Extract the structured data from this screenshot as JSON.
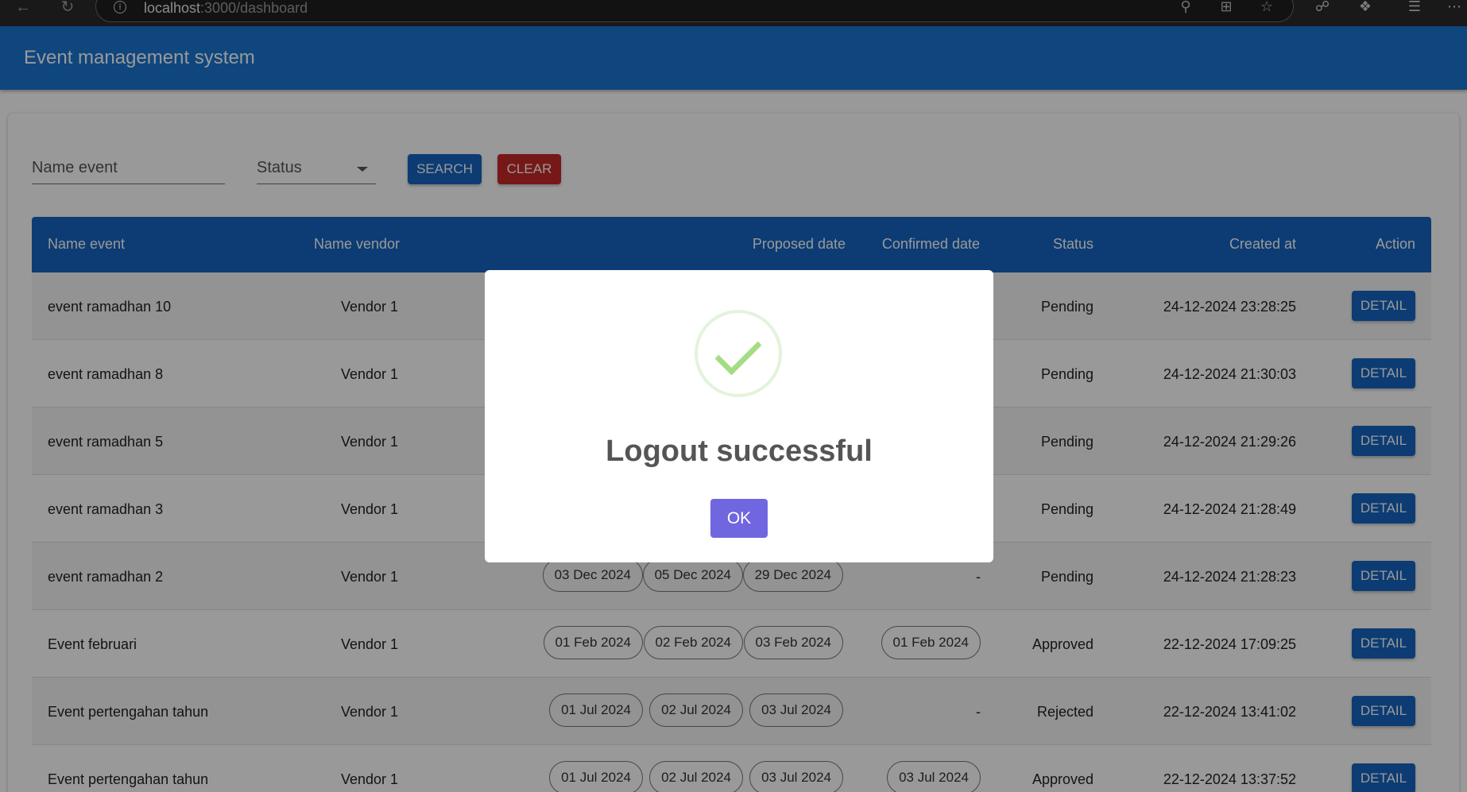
{
  "browser": {
    "url_host": "localhost",
    "url_path": ":3000/dashboard"
  },
  "app": {
    "title": "Event management system"
  },
  "filters": {
    "name_placeholder": "Name event",
    "status_label": "Status",
    "search_label": "SEARCH",
    "clear_label": "CLEAR"
  },
  "table": {
    "headers": [
      "Name event",
      "Name vendor",
      "Proposed date",
      "Confirmed date",
      "Status",
      "Created at",
      "Action"
    ],
    "action_label": "DETAIL",
    "rows": [
      {
        "name": "event ramadhan 10",
        "vendor": "Vendor 1",
        "proposed": [],
        "confirmed": "",
        "status": "Pending",
        "created": "24-12-2024 23:28:25"
      },
      {
        "name": "event ramadhan 8",
        "vendor": "Vendor 1",
        "proposed": [],
        "confirmed": "",
        "status": "Pending",
        "created": "24-12-2024 21:30:03"
      },
      {
        "name": "event ramadhan 5",
        "vendor": "Vendor 1",
        "proposed": [],
        "confirmed": "",
        "status": "Pending",
        "created": "24-12-2024 21:29:26"
      },
      {
        "name": "event ramadhan 3",
        "vendor": "Vendor 1",
        "proposed": [],
        "confirmed": "",
        "status": "Pending",
        "created": "24-12-2024 21:28:49"
      },
      {
        "name": "event ramadhan 2",
        "vendor": "Vendor 1",
        "proposed": [
          "03 Dec 2024",
          "05 Dec 2024",
          "29 Dec 2024"
        ],
        "confirmed": "-",
        "status": "Pending",
        "created": "24-12-2024 21:28:23"
      },
      {
        "name": "Event februari",
        "vendor": "Vendor 1",
        "proposed": [
          "01 Feb 2024",
          "02 Feb 2024",
          "03 Feb 2024"
        ],
        "confirmed": "01 Feb 2024",
        "status": "Approved",
        "created": "22-12-2024 17:09:25"
      },
      {
        "name": "Event pertengahan tahun",
        "vendor": "Vendor 1",
        "proposed": [
          "01 Jul 2024",
          "02 Jul 2024",
          "03 Jul 2024"
        ],
        "confirmed": "-",
        "status": "Rejected",
        "created": "22-12-2024 13:41:02"
      },
      {
        "name": "Event pertengahan tahun",
        "vendor": "Vendor 1",
        "proposed": [
          "01 Jul 2024",
          "02 Jul 2024",
          "03 Jul 2024"
        ],
        "confirmed": "03 Jul 2024",
        "status": "Approved",
        "created": "22-12-2024 13:37:52"
      }
    ]
  },
  "modal": {
    "icon": "success-check-icon",
    "title": "Logout successful",
    "ok_label": "OK"
  },
  "colors": {
    "primary": "#1976d2",
    "header": "#1565c0",
    "clear": "#c62828",
    "ok": "#7066e0",
    "success": "#a5dc86"
  }
}
